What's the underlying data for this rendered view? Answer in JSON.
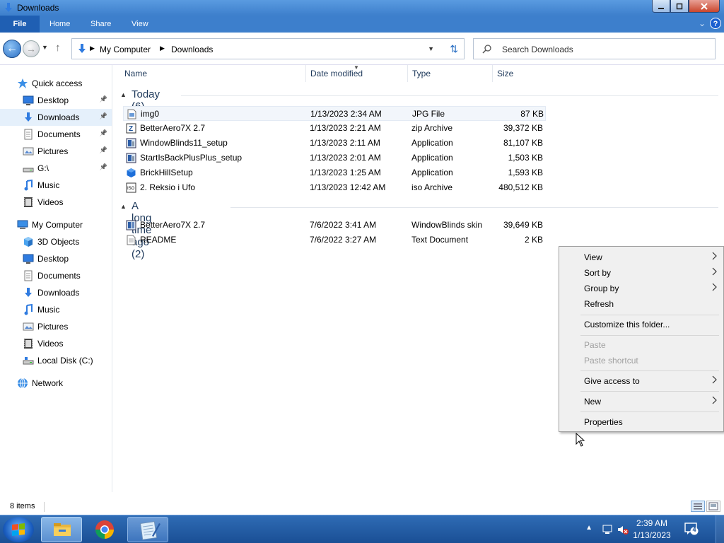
{
  "window": {
    "title": "Downloads"
  },
  "ribbon": {
    "tabs": [
      "File",
      "Home",
      "Share",
      "View"
    ]
  },
  "address": {
    "crumbs": [
      "My Computer",
      "Downloads"
    ]
  },
  "search": {
    "placeholder": "Search Downloads"
  },
  "sidebar": {
    "items": [
      {
        "label": "Quick access",
        "icon": "star-icon",
        "pinned": false
      },
      {
        "label": "Desktop",
        "icon": "desktop-icon",
        "pinned": true
      },
      {
        "label": "Downloads",
        "icon": "download-arrow-icon",
        "pinned": true,
        "selected": true
      },
      {
        "label": "Documents",
        "icon": "documents-icon",
        "pinned": true
      },
      {
        "label": "Pictures",
        "icon": "pictures-icon",
        "pinned": true
      },
      {
        "label": "G:\\",
        "icon": "drive-icon",
        "pinned": true
      },
      {
        "label": "Music",
        "icon": "music-icon",
        "pinned": false
      },
      {
        "label": "Videos",
        "icon": "videos-icon",
        "pinned": false
      },
      {
        "label": "My Computer",
        "icon": "computer-icon",
        "pinned": false
      },
      {
        "label": "3D Objects",
        "icon": "3d-objects-icon",
        "pinned": false
      },
      {
        "label": "Desktop",
        "icon": "desktop-icon",
        "pinned": false
      },
      {
        "label": "Documents",
        "icon": "documents-icon",
        "pinned": false
      },
      {
        "label": "Downloads",
        "icon": "download-arrow-icon",
        "pinned": false
      },
      {
        "label": "Music",
        "icon": "music-icon",
        "pinned": false
      },
      {
        "label": "Pictures",
        "icon": "pictures-icon",
        "pinned": false
      },
      {
        "label": "Videos",
        "icon": "videos-icon",
        "pinned": false
      },
      {
        "label": "Local Disk (C:)",
        "icon": "local-disk-icon",
        "pinned": false
      },
      {
        "label": "Network",
        "icon": "network-icon",
        "pinned": false
      }
    ]
  },
  "columns": [
    "Name",
    "Date modified",
    "Type",
    "Size"
  ],
  "groups": [
    {
      "label": "Today (6)",
      "files": [
        {
          "name": "img0",
          "date": "1/13/2023 2:34 AM",
          "type": "JPG File",
          "size": "87 KB",
          "icon": "image-file-icon"
        },
        {
          "name": "BetterAero7X 2.7",
          "date": "1/13/2023 2:21 AM",
          "type": "zip Archive",
          "size": "39,372 KB",
          "icon": "zip-archive-icon"
        },
        {
          "name": "WindowBlinds11_setup",
          "date": "1/13/2023 2:11 AM",
          "type": "Application",
          "size": "81,107 KB",
          "icon": "installer-icon"
        },
        {
          "name": "StartIsBackPlusPlus_setup",
          "date": "1/13/2023 2:01 AM",
          "type": "Application",
          "size": "1,503 KB",
          "icon": "installer-icon"
        },
        {
          "name": "BrickHillSetup",
          "date": "1/13/2023 1:25 AM",
          "type": "Application",
          "size": "1,593 KB",
          "icon": "brick-icon"
        },
        {
          "name": "2. Reksio i Ufo",
          "date": "1/13/2023 12:42 AM",
          "type": "iso Archive",
          "size": "480,512 KB",
          "icon": "iso-archive-icon"
        }
      ]
    },
    {
      "label": "A long time ago (2)",
      "files": [
        {
          "name": "BetterAero7X 2.7",
          "date": "7/6/2022 3:41 AM",
          "type": "WindowBlinds skin",
          "size": "39,649 KB",
          "icon": "skin-file-icon"
        },
        {
          "name": "README",
          "date": "7/6/2022 3:27 AM",
          "type": "Text Document",
          "size": "2 KB",
          "icon": "text-file-icon"
        }
      ]
    }
  ],
  "status": {
    "item_count": "8 items"
  },
  "context_menu": {
    "items": [
      {
        "label": "View",
        "submenu": true,
        "disabled": false
      },
      {
        "label": "Sort by",
        "submenu": true,
        "disabled": false
      },
      {
        "label": "Group by",
        "submenu": true,
        "disabled": false
      },
      {
        "label": "Refresh",
        "submenu": false,
        "disabled": false
      },
      {
        "label": "Customize this folder...",
        "submenu": false,
        "disabled": false
      },
      {
        "label": "Paste",
        "submenu": false,
        "disabled": true
      },
      {
        "label": "Paste shortcut",
        "submenu": false,
        "disabled": true
      },
      {
        "label": "Give access to",
        "submenu": true,
        "disabled": false
      },
      {
        "label": "New",
        "submenu": true,
        "disabled": false
      },
      {
        "label": "Properties",
        "submenu": false,
        "disabled": false
      }
    ]
  },
  "taskbar": {
    "apps": [
      "file-explorer-icon",
      "chrome-icon",
      "notepad-icon"
    ],
    "time": "2:39 AM",
    "date": "1/13/2023",
    "notification_count": "4"
  },
  "colors": {
    "title_blue": "#3d7fcc",
    "file_tab": "#1f5fb3",
    "selection": "#e5f0fb",
    "taskbar": "#1a4f95"
  }
}
